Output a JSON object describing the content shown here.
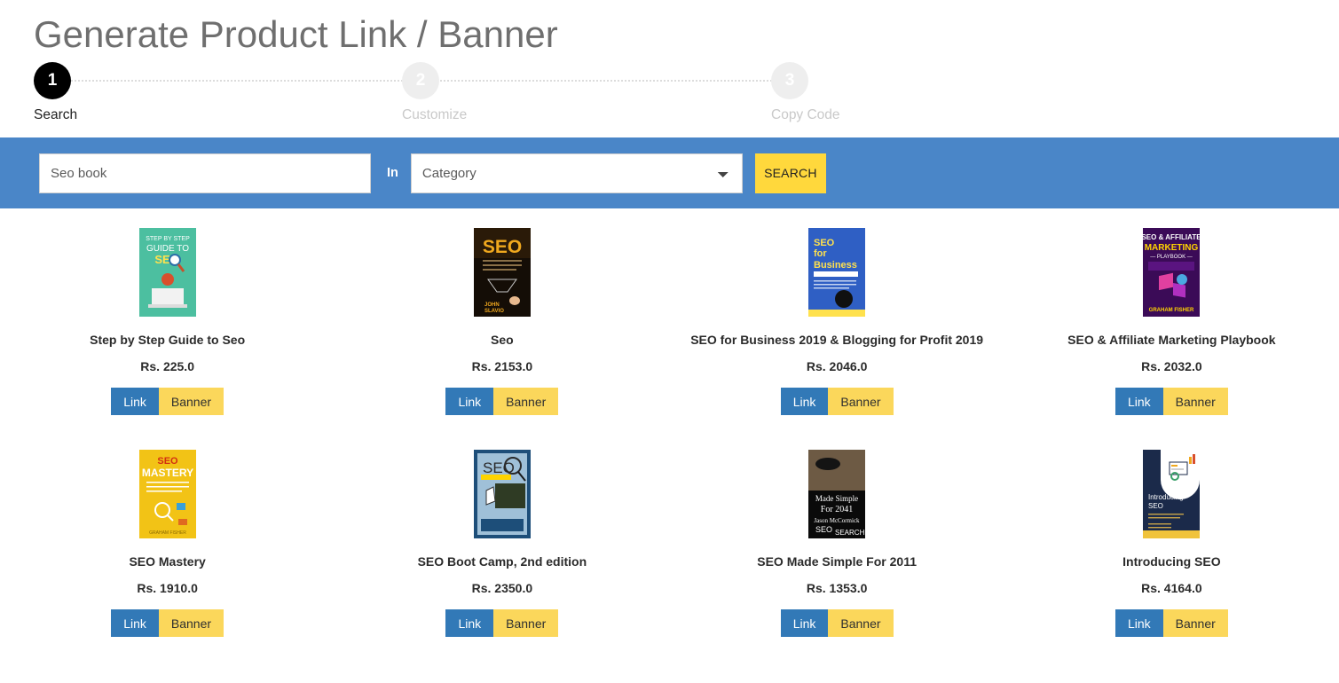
{
  "header": {
    "title": "Generate Product Link / Banner"
  },
  "stepper": {
    "steps": [
      {
        "number": "1",
        "label": "Search",
        "state": "active"
      },
      {
        "number": "2",
        "label": "Customize",
        "state": "inactive"
      },
      {
        "number": "3",
        "label": "Copy Code",
        "state": "inactive"
      }
    ]
  },
  "search": {
    "query_value": "Seo book",
    "query_placeholder": "Seo book",
    "in_label": "In",
    "category_selected": "Category",
    "category_options": [
      "Category"
    ],
    "button_label": "SEARCH",
    "bar_color": "#4a86c8",
    "button_color": "#ffd83c"
  },
  "products": [
    {
      "title": "Step by Step Guide to Seo",
      "price": "Rs. 225.0",
      "link_label": "Link",
      "banner_label": "Banner",
      "cover": "step-by-step-guide-to-seo-cover"
    },
    {
      "title": "Seo",
      "price": "Rs. 2153.0",
      "link_label": "Link",
      "banner_label": "Banner",
      "cover": "seo-john-slavio-cover"
    },
    {
      "title": "SEO for Business 2019 & Blogging for Profit 2019",
      "price": "Rs. 2046.0",
      "link_label": "Link",
      "banner_label": "Banner",
      "cover": "seo-for-business-2019-cover"
    },
    {
      "title": "SEO & Affiliate Marketing Playbook",
      "price": "Rs. 2032.0",
      "link_label": "Link",
      "banner_label": "Banner",
      "cover": "seo-affiliate-marketing-playbook-cover"
    },
    {
      "title": "SEO Mastery",
      "price": "Rs. 1910.0",
      "link_label": "Link",
      "banner_label": "Banner",
      "cover": "seo-mastery-cover"
    },
    {
      "title": "SEO Boot Camp, 2nd edition",
      "price": "Rs. 2350.0",
      "link_label": "Link",
      "banner_label": "Banner",
      "cover": "seo-boot-camp-cover"
    },
    {
      "title": "SEO Made Simple For 2011",
      "price": "Rs. 1353.0",
      "link_label": "Link",
      "banner_label": "Banner",
      "cover": "seo-made-simple-2011-cover"
    },
    {
      "title": "Introducing SEO",
      "price": "Rs. 4164.0",
      "link_label": "Link",
      "banner_label": "Banner",
      "cover": "introducing-seo-cover"
    }
  ],
  "colors": {
    "accent_blue": "#4a86c8",
    "accent_yellow": "#ffd83c",
    "link_button": "#3279b7",
    "banner_button": "#fbd75b",
    "title_gray": "#6f6f6f"
  }
}
